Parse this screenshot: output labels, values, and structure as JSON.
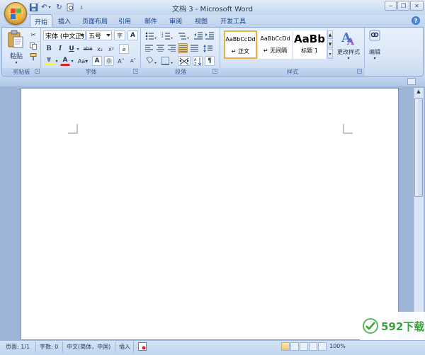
{
  "window": {
    "title": "文档 3 - Microsoft Word"
  },
  "tabs": [
    "开始",
    "插入",
    "页面布局",
    "引用",
    "邮件",
    "审阅",
    "视图",
    "开发工具"
  ],
  "clipboard": {
    "paste_label": "粘贴",
    "group_label": "剪贴板"
  },
  "font": {
    "name": "宋体 (中文正)",
    "size": "五号",
    "group_label": "字体"
  },
  "paragraph": {
    "group_label": "段落"
  },
  "styles": {
    "group_label": "样式",
    "items": [
      {
        "preview": "AaBbCcDd",
        "label": "↵ 正文"
      },
      {
        "preview": "AaBbCcDd",
        "label": "↵ 无间隔"
      },
      {
        "preview": "AaBb",
        "label": "标题 1"
      }
    ],
    "change_label": "更改样式"
  },
  "editing": {
    "label": "编辑"
  },
  "status": {
    "page": "页面: 1/1",
    "words": "字数: 0",
    "language": "中文(简体，中国)",
    "mode": "插入",
    "zoom": "100%"
  },
  "watermark": {
    "text": "592下载"
  }
}
